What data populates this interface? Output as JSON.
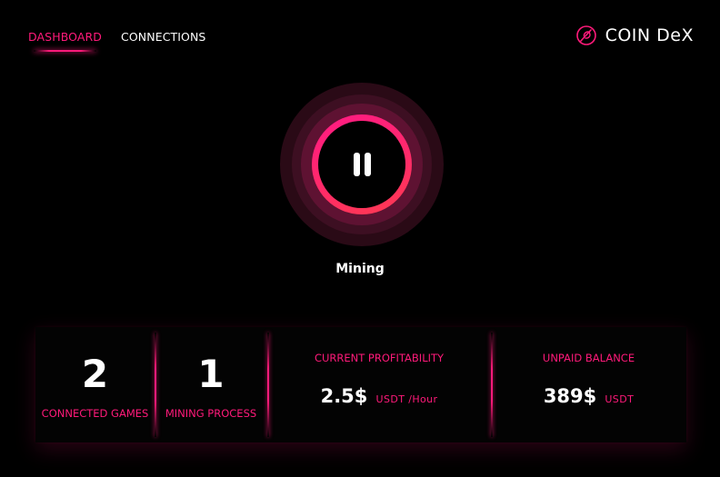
{
  "nav": {
    "items": [
      {
        "label": "DASHBOARD",
        "active": true
      },
      {
        "label": "CONNECTIONS",
        "active": false
      }
    ]
  },
  "brand": {
    "name": "COIN DeX",
    "icon": "coin-logo-icon"
  },
  "mining": {
    "status_label": "Mining",
    "control_icon": "pause-icon"
  },
  "stats": {
    "connected_games": {
      "value": "2",
      "label": "CONNECTED GAMES"
    },
    "mining_process": {
      "value": "1",
      "label": "MINING PROCESS"
    },
    "current_profitability": {
      "label": "CURRENT PROFITABILITY",
      "value": "2.5$",
      "unit": "USDT /Hour"
    },
    "unpaid_balance": {
      "label": "UNPAID BALANCE",
      "value": "389$",
      "unit": "USDT"
    }
  },
  "colors": {
    "accent": "#ff1a7a",
    "background": "#000000",
    "text": "#ffffff"
  }
}
